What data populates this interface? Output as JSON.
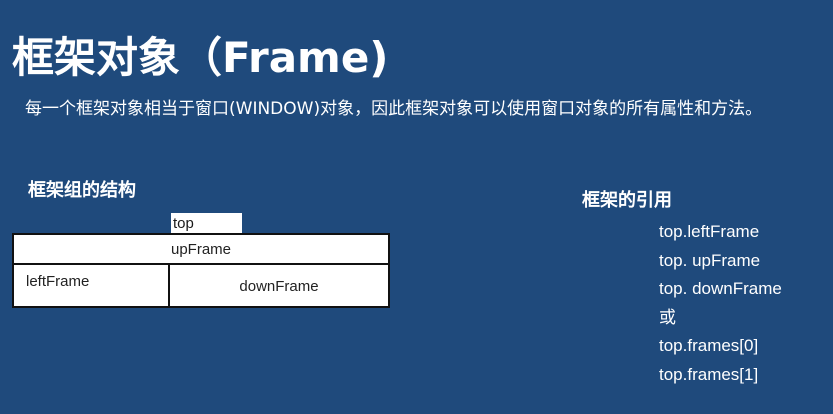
{
  "slide": {
    "title": "框架对象（Frame)",
    "description": "每一个框架对象相当于窗口(WINDOW)对象，因此框架对象可以使用窗口对象的所有属性和方法。",
    "structure_heading": "框架组的结构",
    "reference_heading": "框架的引用"
  },
  "diagram": {
    "top_label": "top",
    "up_frame": "upFrame",
    "left_frame": "leftFrame",
    "down_frame": "downFrame"
  },
  "references": [
    "top.leftFrame",
    "top. upFrame",
    "top. downFrame",
    "或",
    "top.frames[0]",
    "top.frames[1]"
  ]
}
